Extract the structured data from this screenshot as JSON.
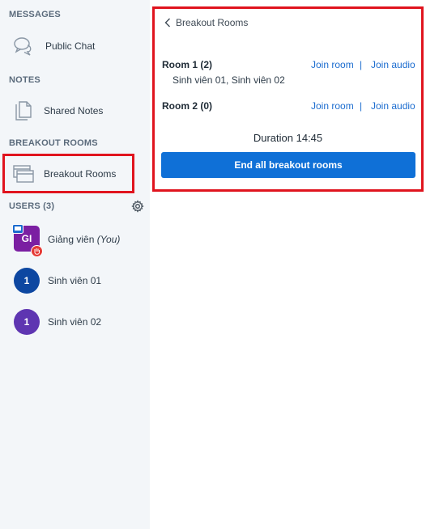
{
  "sidebar": {
    "messages_title": "MESSAGES",
    "public_chat_label": "Public Chat",
    "notes_title": "NOTES",
    "shared_notes_label": "Shared Notes",
    "breakout_title": "BREAKOUT ROOMS",
    "breakout_rooms_label": "Breakout Rooms",
    "users_title": "USERS (3)"
  },
  "users": [
    {
      "initials": "GI",
      "name": "Giảng viên",
      "suffix": "(You)",
      "color": "#7b1fa2"
    },
    {
      "initials": "1",
      "name": "Sinh viên 01",
      "color": "#0d47a1"
    },
    {
      "initials": "1",
      "name": "Sinh viên 02",
      "color": "#5e35b1"
    }
  ],
  "panel": {
    "back_label": "Breakout Rooms",
    "rooms": [
      {
        "title": "Room 1 (2)",
        "members": "Sinh viên 01, Sinh viên 02",
        "join_room": "Join room",
        "separator": "|",
        "join_audio": "Join audio"
      },
      {
        "title": "Room 2 (0)",
        "members": "",
        "join_room": "Join room",
        "separator": "|",
        "join_audio": "Join audio"
      }
    ],
    "duration": "Duration 14:45",
    "end_button": "End all breakout rooms"
  },
  "colors": {
    "accent": "#0f70d7",
    "link": "#1b6ccf",
    "highlight": "#e0141e",
    "sidebar_bg": "#f3f6f9"
  }
}
